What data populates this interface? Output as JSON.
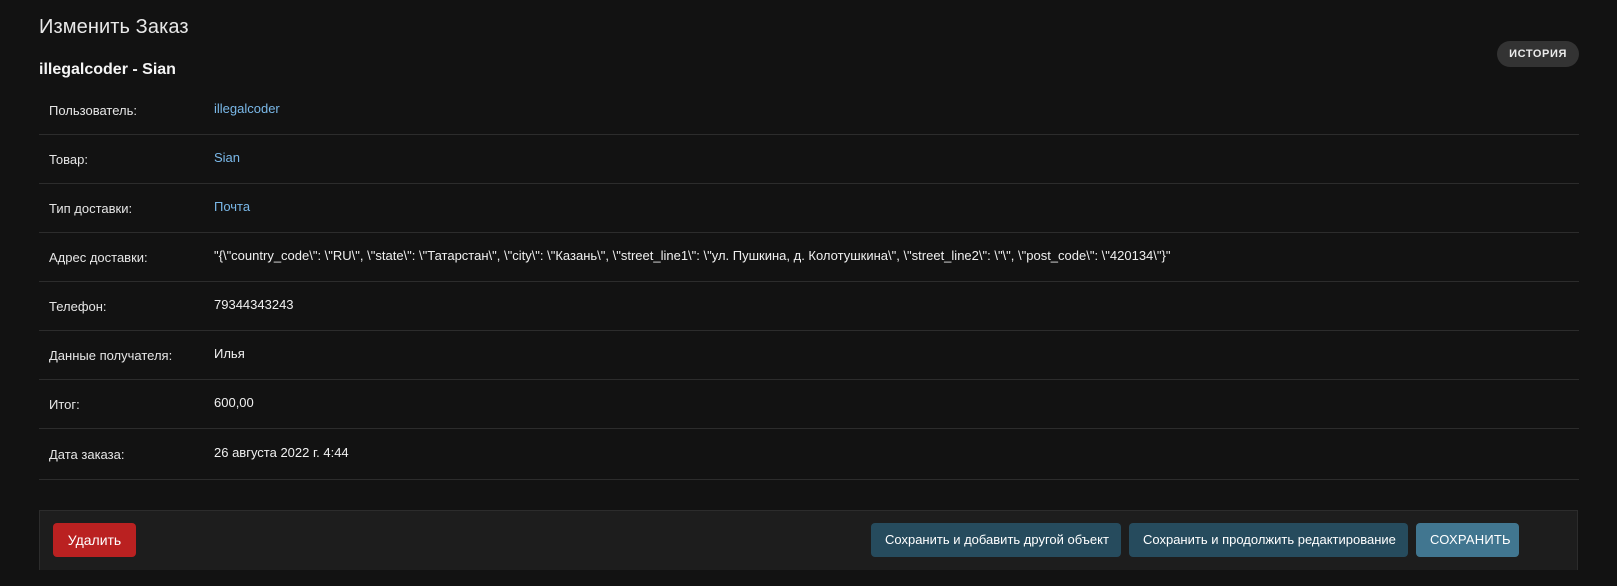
{
  "header": {
    "title": "Изменить Заказ",
    "object_title": "illegalcoder - Sian",
    "history_label": "История"
  },
  "fields": [
    {
      "label": "Пользователь:",
      "value": "illegalcoder",
      "link": true
    },
    {
      "label": "Товар:",
      "value": "Sian",
      "link": true
    },
    {
      "label": "Тип доставки:",
      "value": "Почта",
      "link": true
    },
    {
      "label": "Адрес доставки:",
      "value": "\"{\\\"country_code\\\": \\\"RU\\\", \\\"state\\\": \\\"Татарстан\\\", \\\"city\\\": \\\"Казань\\\", \\\"street_line1\\\": \\\"ул. Пушкина, д. Колотушкина\\\", \\\"street_line2\\\": \\\"\\\", \\\"post_code\\\": \\\"420134\\\"}\"",
      "link": false
    },
    {
      "label": "Телефон:",
      "value": "79344343243",
      "link": false
    },
    {
      "label": "Данные получателя:",
      "value": "Илья",
      "link": false
    },
    {
      "label": "Итог:",
      "value": "600,00",
      "link": false
    },
    {
      "label": "Дата заказа:",
      "value": "26 августа 2022 г. 4:44",
      "link": false
    }
  ],
  "actions": {
    "delete_label": "Удалить",
    "save_add_label": "Сохранить и добавить другой объект",
    "save_continue_label": "Сохранить и продолжить редактирование",
    "save_label": "Сохранить"
  },
  "colors": {
    "background": "#121212",
    "link": "#7ab8e8",
    "delete": "#ba2121",
    "secondary_button": "#264b5d",
    "primary_button": "#417690"
  }
}
